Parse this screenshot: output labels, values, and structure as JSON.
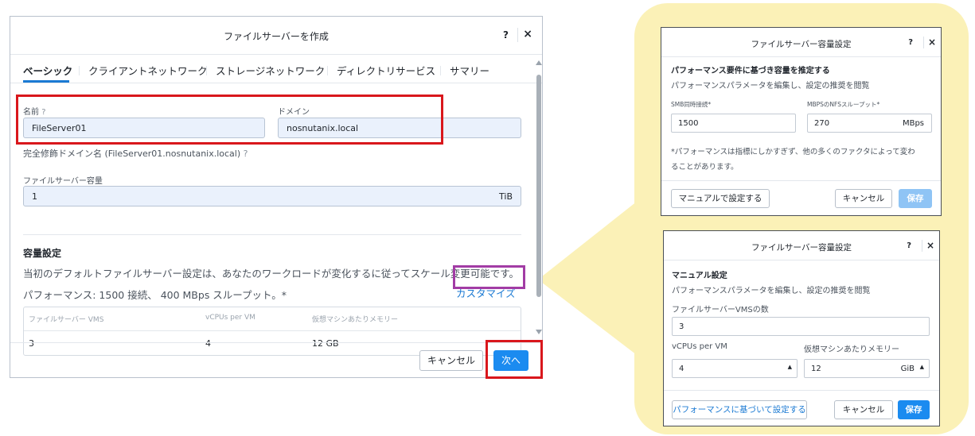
{
  "main_dialog": {
    "title": "ファイルサーバーを作成",
    "help": "?",
    "close": "×",
    "tabs": [
      "ベーシック",
      "クライアントネットワーク",
      "ストレージネットワーク",
      "ディレクトリサービス",
      "サマリー"
    ],
    "name_label": "名前",
    "name_help": "?",
    "name_value": "FileServer01",
    "domain_label": "ドメイン",
    "domain_value": "nosnutanix.local",
    "fqdn_text": "完全修飾ドメイン名 (FileServer01.nosnutanix.local)",
    "fqdn_help": "?",
    "capacity_label": "ファイルサーバー容量",
    "capacity_value": "1",
    "capacity_unit": "TiB",
    "section_title": "容量設定",
    "section_text": "当初のデフォルトファイルサーバー設定は、あなたのワークロードが変化するに従ってスケール変更可能です。",
    "performance_text": "パフォーマンス: 1500 接続、 400 MBps スループット。*",
    "customize_link": "カスタマイズ",
    "vm_table": {
      "headers": [
        "ファイルサーバー VMS",
        "vCPUs per VM",
        "仮想マシンあたりメモリー"
      ],
      "row": [
        "3",
        "4",
        "12 GB"
      ]
    },
    "cancel_button": "キャンセル",
    "next_button": "次へ"
  },
  "panel_top": {
    "title": "ファイルサーバー容量設定",
    "help": "?",
    "close": "×",
    "heading": "パフォーマンス要件に基づき容量を推定する",
    "subtext": "パフォーマンスパラメータを編集し、設定の推奨を閲覧",
    "smb_label": "SMB同時接続*",
    "smb_value": "1500",
    "nfs_label": "MBPSのNFSスループット*",
    "nfs_value": "270",
    "nfs_unit": "MBps",
    "note_line1": "*パフォーマンスは指標にしかすぎず、他の多くのファクタによって変わ",
    "note_line2": "ることがあります。",
    "manual_button": "マニュアルで設定する",
    "cancel_button": "キャンセル",
    "save_button": "保存"
  },
  "panel_bottom": {
    "title": "ファイルサーバー容量設定",
    "help": "?",
    "close": "×",
    "heading": "マニュアル設定",
    "subtext": "パフォーマンスパラメータを編集し、設定の推奨を閲覧",
    "vms_label": "ファイルサーバーVMSの数",
    "vms_value": "3",
    "vcpu_label": "vCPUs per VM",
    "vcpu_value": "4",
    "mem_label": "仮想マシンあたりメモリー",
    "mem_value": "12",
    "mem_unit": "GiB",
    "perf_button": "パフォーマンスに基づいて設定する",
    "cancel_button": "キャンセル",
    "save_button": "保存"
  },
  "colors": {
    "accent": "#1b8bf0",
    "highlight_red": "#d9171c",
    "highlight_purple": "#a23ca5",
    "callout": "#fbf1b7"
  }
}
